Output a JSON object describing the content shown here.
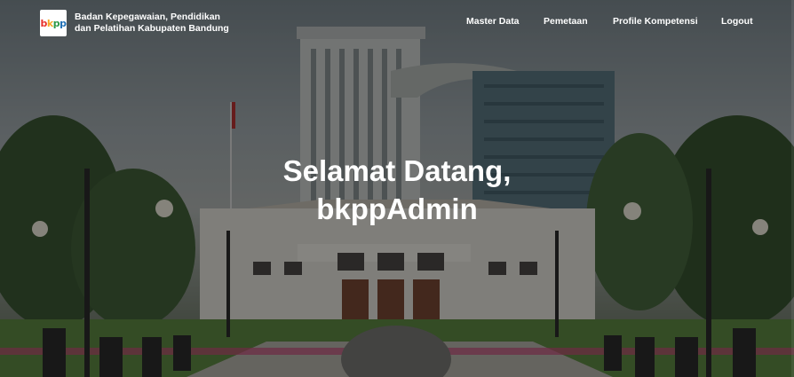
{
  "brand": {
    "logo_text": "bkpp",
    "line1": "Badan Kepegawaian, Pendidikan",
    "line2": "dan Pelatihan Kabupaten Bandung"
  },
  "nav": {
    "items": [
      "Master Data",
      "Pemetaan",
      "Profile Kompetensi",
      "Logout"
    ]
  },
  "hero": {
    "line1": "Selamat Datang,",
    "line2": "bkppAdmin"
  },
  "colors": {
    "overlay": "rgba(0,0,0,0.45)",
    "text": "#ffffff",
    "logo_b": "#e8312d",
    "logo_k": "#f6a623",
    "logo_p1": "#2e9a48",
    "logo_p2": "#1f6fb5"
  }
}
